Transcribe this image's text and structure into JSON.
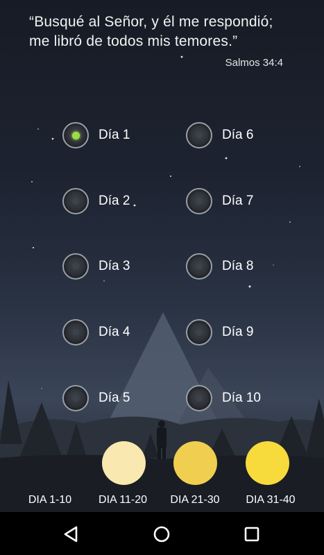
{
  "verse": {
    "text_line1": "“Busqué al Señor, y él me respondió;",
    "text_line2": "me libró de todos mis temores.”",
    "reference": "Salmos 34:4"
  },
  "days": [
    {
      "label": "Día 1",
      "checked": true
    },
    {
      "label": "Día 2",
      "checked": false
    },
    {
      "label": "Día 3",
      "checked": false
    },
    {
      "label": "Día 4",
      "checked": false
    },
    {
      "label": "Día 5",
      "checked": false
    },
    {
      "label": "Día 6",
      "checked": false
    },
    {
      "label": "Día 7",
      "checked": false
    },
    {
      "label": "Día 8",
      "checked": false
    },
    {
      "label": "Día 9",
      "checked": false
    },
    {
      "label": "Día 10",
      "checked": false
    }
  ],
  "phases": [
    {
      "label": "DIA 1-10",
      "color": null
    },
    {
      "label": "DIA 11-20",
      "color": "#f9e8b0"
    },
    {
      "label": "DIA 21-30",
      "color": "#f0cf50"
    },
    {
      "label": "DIA 31-40",
      "color": "#f7da3c"
    }
  ],
  "colors": {
    "checked_dot": "#9be043",
    "radio_ring": "#9aa0a8"
  },
  "navbar": {
    "icons": [
      "back-icon",
      "home-icon",
      "recents-icon"
    ]
  }
}
